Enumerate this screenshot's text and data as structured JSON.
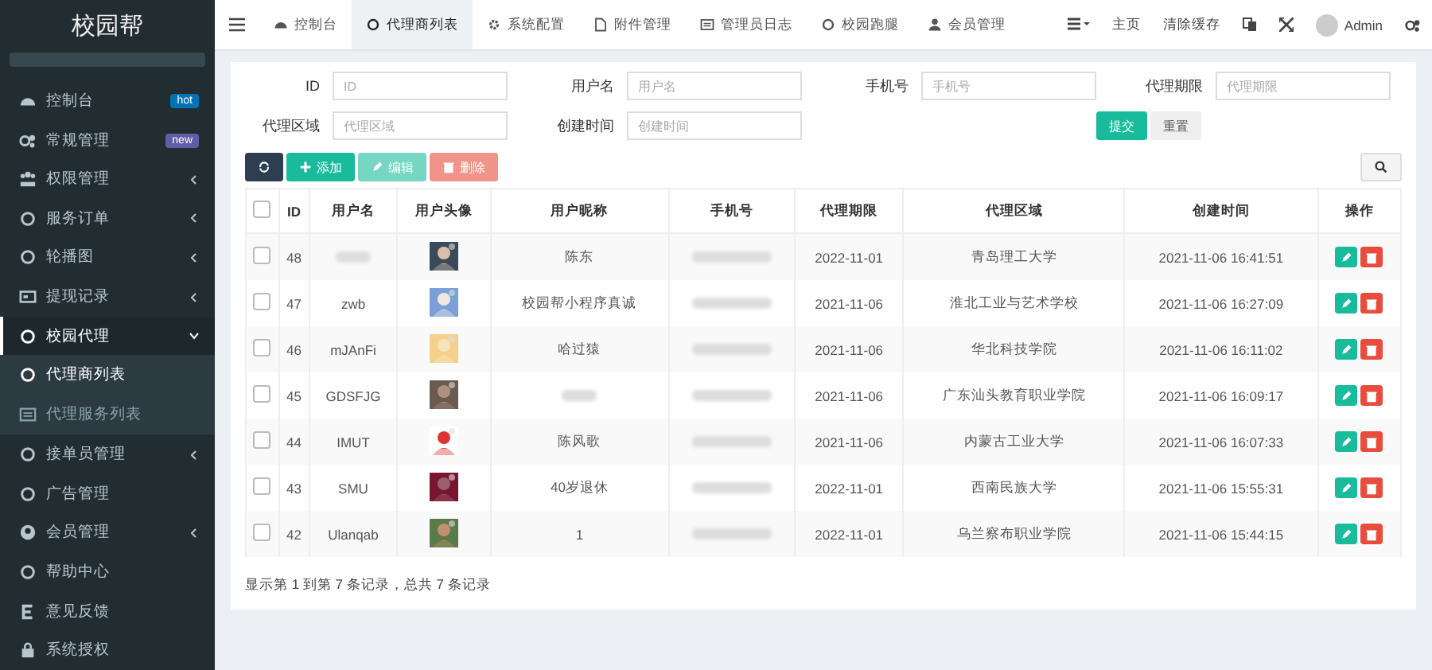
{
  "sidebar": {
    "logo": "校园帮",
    "items": [
      {
        "label": "控制台",
        "badge": {
          "text": "hot",
          "color": "#0073b7"
        },
        "selected": false
      },
      {
        "label": "常规管理",
        "badge": {
          "text": "new",
          "color": "#605ca8"
        },
        "selected": false
      },
      {
        "label": "权限管理",
        "expanded": false,
        "selected": false
      },
      {
        "label": "服务订单",
        "expanded": false,
        "selected": false
      },
      {
        "label": "轮播图",
        "expanded": false,
        "selected": false
      },
      {
        "label": "提现记录",
        "expanded": false,
        "selected": false
      },
      {
        "label": "校园代理",
        "expanded": true,
        "selected": true,
        "children": [
          {
            "label": "代理商列表",
            "selected": true
          },
          {
            "label": "代理服务列表",
            "selected": false
          }
        ]
      },
      {
        "label": "接单员管理",
        "expanded": false,
        "selected": false
      },
      {
        "label": "广告管理",
        "selected": false
      },
      {
        "label": "会员管理",
        "expanded": false,
        "selected": false
      },
      {
        "label": "帮助中心",
        "selected": false
      },
      {
        "label": "意见反馈",
        "selected": false
      },
      {
        "label": "系统授权",
        "selected": false
      }
    ]
  },
  "top_tabs": [
    {
      "label": "控制台",
      "selected": false
    },
    {
      "label": "代理商列表",
      "selected": true
    },
    {
      "label": "系统配置",
      "selected": false
    },
    {
      "label": "附件管理",
      "selected": false
    },
    {
      "label": "管理员日志",
      "selected": false
    },
    {
      "label": "校园跑腿",
      "selected": false
    },
    {
      "label": "会员管理",
      "selected": false
    }
  ],
  "top_right": {
    "home": "主页",
    "clear_cache": "清除缓存",
    "user": "Admin"
  },
  "filters": [
    {
      "label": "ID",
      "placeholder": "ID"
    },
    {
      "label": "用户名",
      "placeholder": "用户名"
    },
    {
      "label": "手机号",
      "placeholder": "手机号"
    },
    {
      "label": "代理期限",
      "placeholder": "代理期限"
    },
    {
      "label": "代理区域",
      "placeholder": "代理区域"
    },
    {
      "label": "创建时间",
      "placeholder": "创建时间"
    }
  ],
  "filter_buttons": {
    "submit": "提交",
    "reset": "重置"
  },
  "toolbar": [
    {
      "kind": "refresh",
      "disabled": false
    },
    {
      "kind": "add",
      "label": "添加",
      "disabled": false
    },
    {
      "kind": "edit",
      "label": "编辑",
      "disabled": true
    },
    {
      "kind": "delete",
      "label": "删除",
      "disabled": true
    }
  ],
  "table": {
    "select_all_checked": false,
    "columns": [
      "ID",
      "用户名",
      "用户头像",
      "用户昵称",
      "手机号",
      "代理期限",
      "代理区域",
      "创建时间",
      "操作"
    ],
    "rows": [
      {
        "checked": false,
        "id": "48",
        "username_hidden": true,
        "nickname": "陈东",
        "phone_hidden": true,
        "term": "2022-11-01",
        "region": "青岛理工大学",
        "created": "2021-11-06 16:41:51"
      },
      {
        "checked": false,
        "id": "47",
        "username": "zwb",
        "nickname": "校园帮小程序真诚",
        "phone_hidden": true,
        "term": "2021-11-06",
        "region": "淮北工业与艺术学校",
        "created": "2021-11-06 16:27:09"
      },
      {
        "checked": false,
        "id": "46",
        "username": "mJAnFi",
        "nickname": "哈过猿",
        "phone_hidden": true,
        "term": "2021-11-06",
        "region": "华北科技学院",
        "created": "2021-11-06 16:11:02"
      },
      {
        "checked": false,
        "id": "45",
        "username": "GDSFJG",
        "nickname_hidden": true,
        "phone_hidden": true,
        "term": "2021-11-06",
        "region": "广东汕头教育职业学院",
        "created": "2021-11-06 16:09:17"
      },
      {
        "checked": false,
        "id": "44",
        "username": "IMUT",
        "nickname": "陈风歌",
        "phone_hidden": true,
        "term": "2021-11-06",
        "region": "内蒙古工业大学",
        "created": "2021-11-06 16:07:33"
      },
      {
        "checked": false,
        "id": "43",
        "username": "SMU",
        "nickname": "40岁退休",
        "phone_hidden": true,
        "term": "2022-11-01",
        "region": "西南民族大学",
        "created": "2021-11-06 15:55:31"
      },
      {
        "checked": false,
        "id": "42",
        "username": "Ulanqab",
        "nickname": "1",
        "phone_hidden": true,
        "term": "2022-11-01",
        "region": "乌兰察布职业学院",
        "created": "2021-11-06 15:44:15"
      }
    ]
  },
  "pagination_info": "显示第 1 到第 7 条记录，总共 7 条记录"
}
